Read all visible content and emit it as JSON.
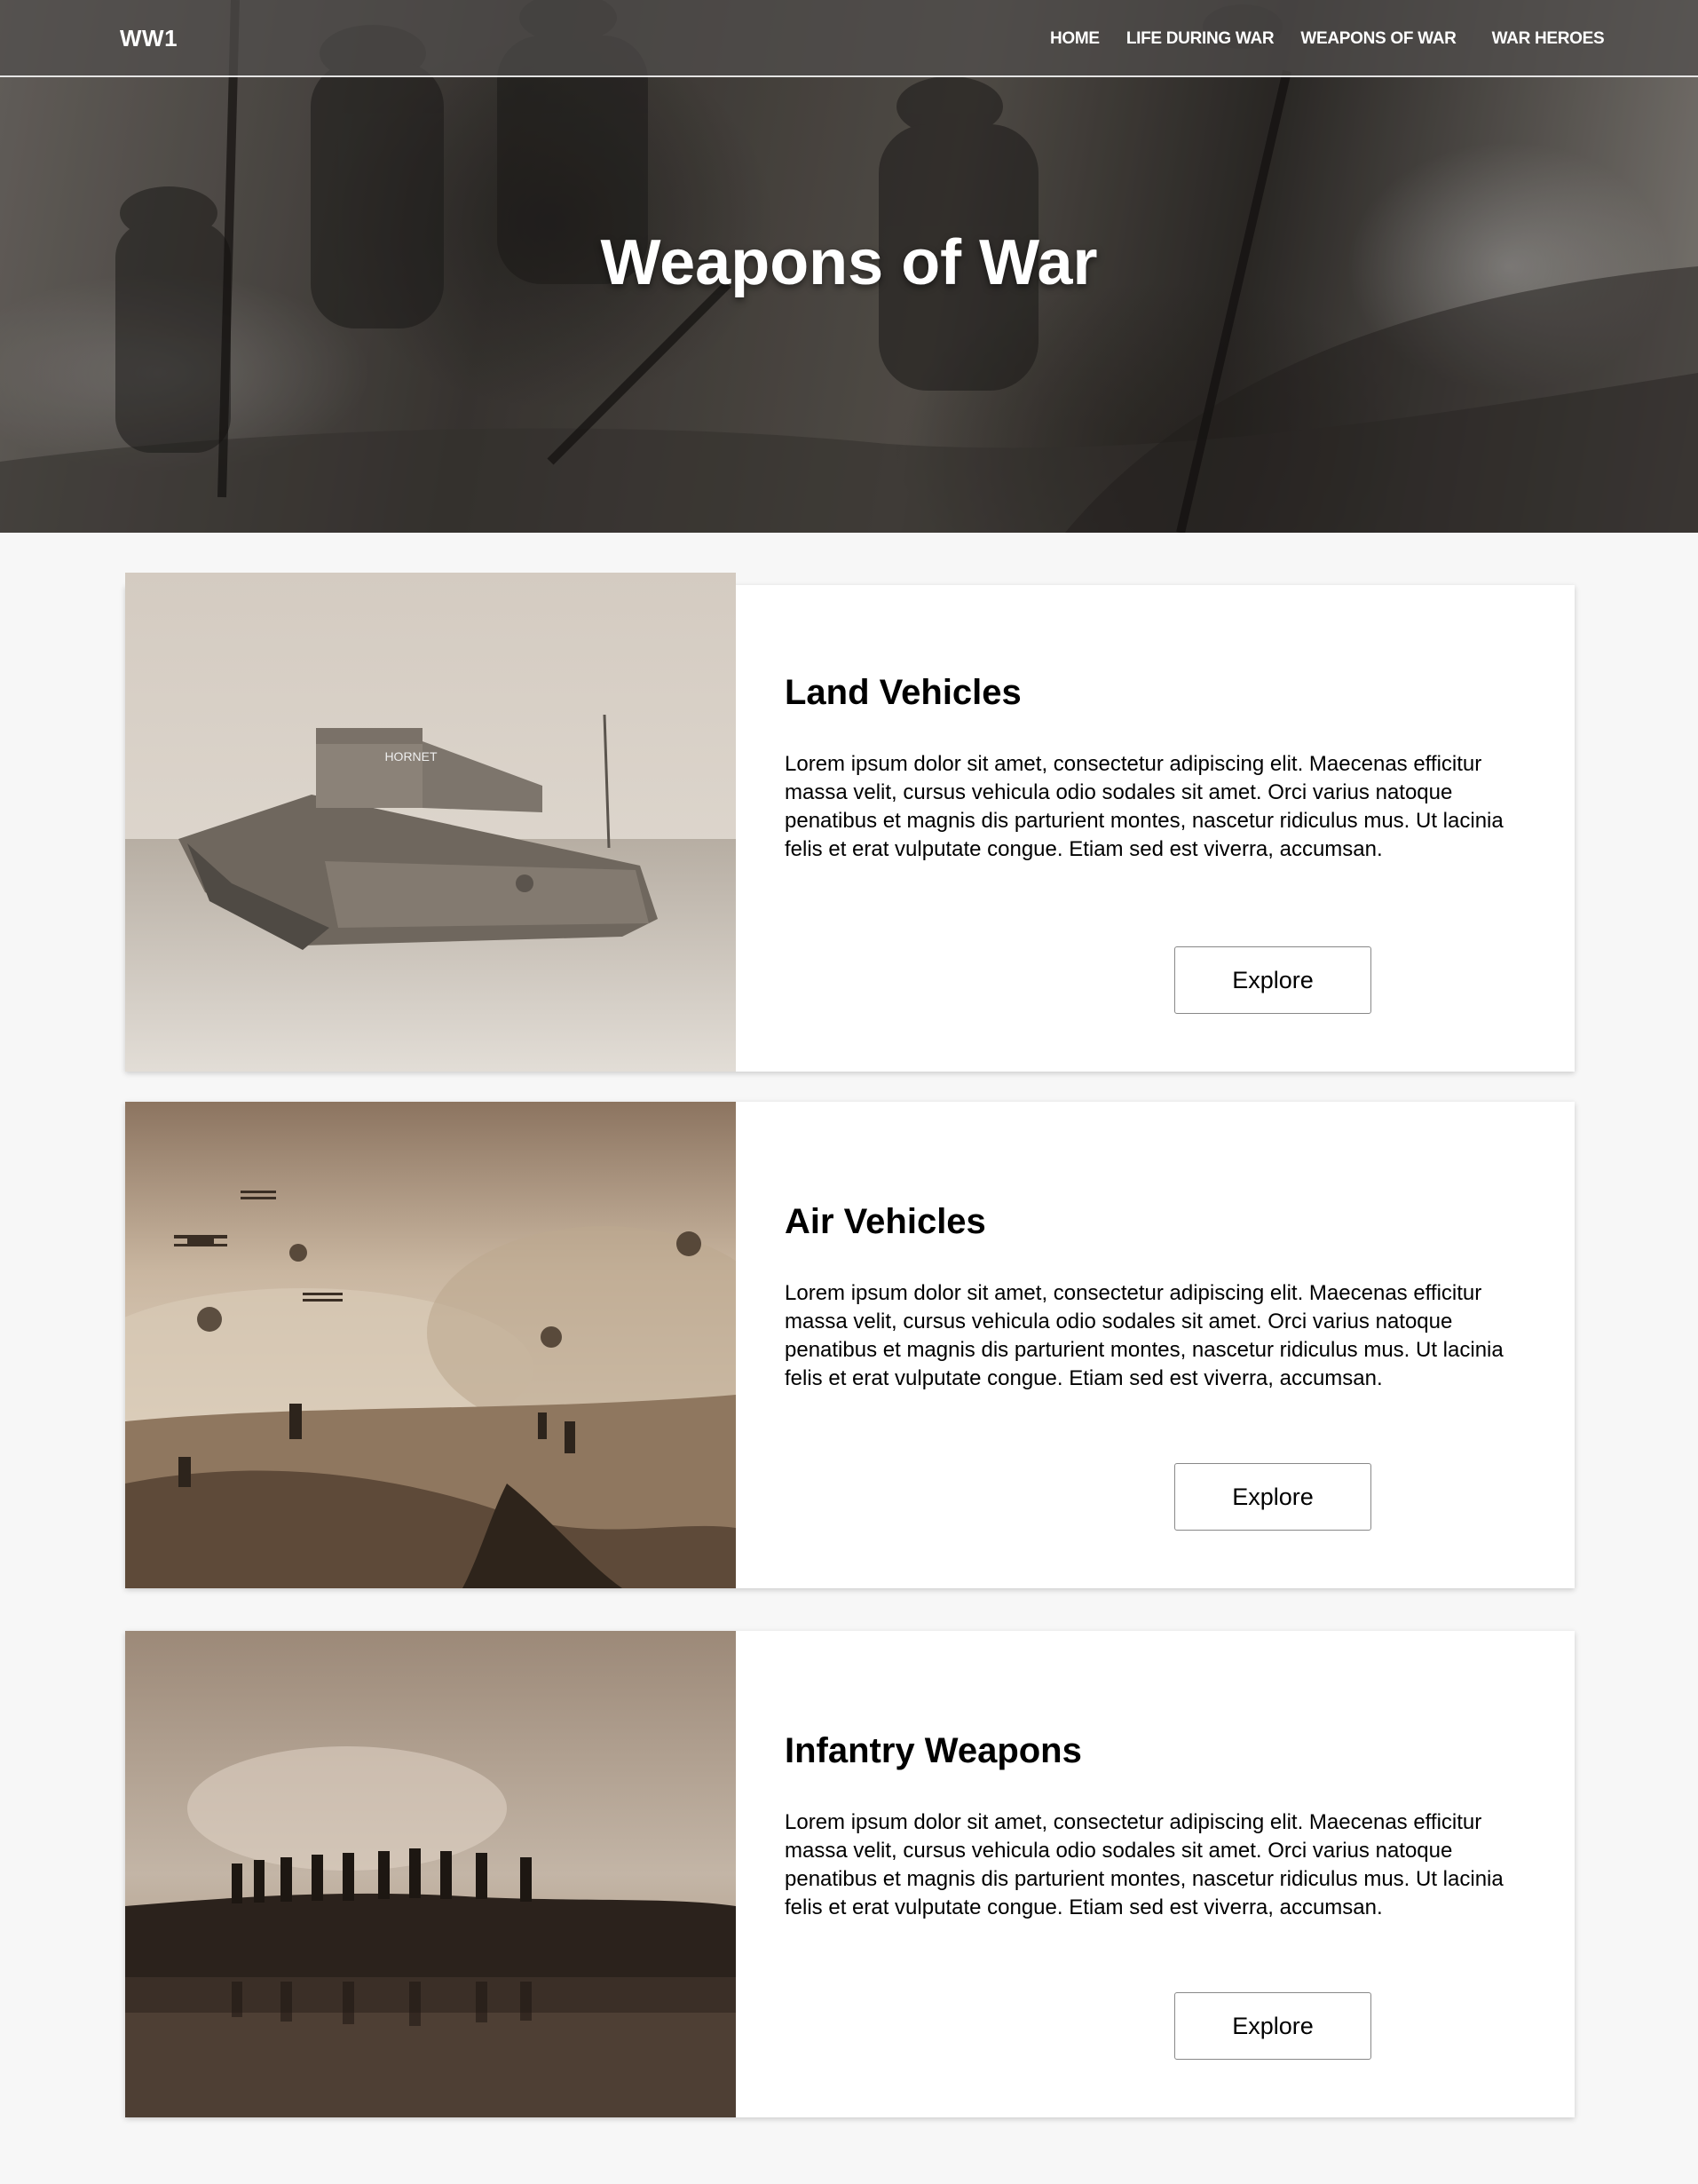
{
  "navbar": {
    "brand": "WW1",
    "links": [
      {
        "label": "HOME"
      },
      {
        "label": "LIFE DURING WAR"
      },
      {
        "label": "WEAPONS OF WAR"
      },
      {
        "label": "WAR HEROES"
      }
    ]
  },
  "hero": {
    "title": "Weapons of War"
  },
  "cards": [
    {
      "heading": "Land Vehicles",
      "body": "Lorem ipsum dolor sit amet, consectetur adipiscing elit. Maecenas efficitur massa velit, cursus vehicula odio sodales sit amet. Orci varius natoque penatibus et magnis dis parturient montes, nascetur ridiculus mus. Ut lacinia felis et erat vulputate congue. Etiam sed est viverra, accumsan.",
      "button": "Explore",
      "tank_text": "HORNET"
    },
    {
      "heading": "Air Vehicles",
      "body": "Lorem ipsum dolor sit amet, consectetur adipiscing elit. Maecenas efficitur massa velit, cursus vehicula odio sodales sit amet. Orci varius natoque penatibus et magnis dis parturient montes, nascetur ridiculus mus. Ut lacinia felis et erat vulputate congue. Etiam sed est viverra, accumsan.",
      "button": "Explore"
    },
    {
      "heading": "Infantry Weapons",
      "body": "Lorem ipsum dolor sit amet, consectetur adipiscing elit. Maecenas efficitur massa velit, cursus vehicula odio sodales sit amet. Orci varius natoque penatibus et magnis dis parturient montes, nascetur ridiculus mus. Ut lacinia felis et erat vulputate congue. Etiam sed est viverra, accumsan.",
      "button": "Explore"
    }
  ],
  "colors": {
    "page_background": "#f7f7f7",
    "card_background": "#ffffff",
    "navbar_overlay": "#504e4c",
    "text": "#000000",
    "nav_text": "#ffffff"
  }
}
